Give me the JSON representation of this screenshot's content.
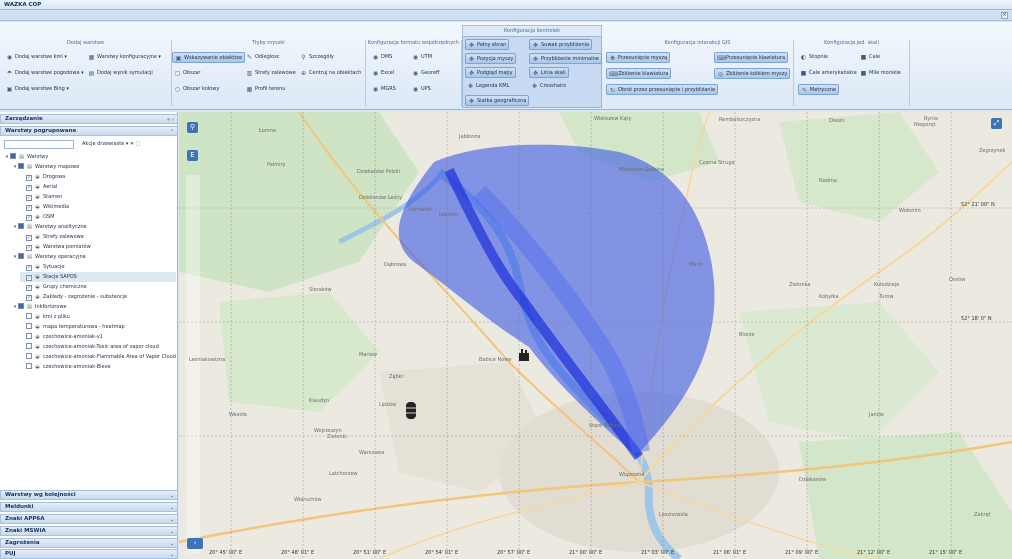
{
  "window": {
    "title": "WAZKA COP"
  },
  "ribbon": {
    "kontrolki_title": "Konfiguracja kontrolek",
    "groups": {
      "warstwy": {
        "title": "Dodaj warstwe",
        "items": [
          "Dodaj warstwe kml ▾",
          "Warstwy konfiguracyjne ▾",
          "Dodaj warstwe pogodowa ▾",
          "Dodaj wynik symulacji",
          "Dodaj warstwe Bing ▾"
        ]
      },
      "tryby": {
        "title": "Tryby myszki",
        "items": [
          "Wskazywanie obiektów",
          "Odleglosc",
          "Szczegóły",
          "Obszar",
          "Strefy zalewowe",
          "Centruj na obiektach",
          "Obszar kołowy",
          "Profil terenu"
        ]
      },
      "format": {
        "title": "Konfiguracja formatu współrzędnych",
        "items": [
          "DMS",
          "UTM",
          "Excel",
          "Georeff",
          "MGRS",
          "UPS"
        ]
      },
      "kontrolki": {
        "items": [
          "Pełny ekran",
          "Suwak przybliżenia",
          "Pozycja myszy",
          "Przybliżenie minimalne",
          "Podgląd mapy",
          "Linia skali",
          "Legenda KML",
          "Crosshairs",
          "Siatka geograficzna"
        ]
      },
      "interakcja": {
        "title": "Konfiguracja interakcji GIS",
        "items": [
          "Przesunięcie myszą",
          "Przesunięcie klawiatura",
          "Zbliżenie klawiatura",
          "Zbliżenie kółkiem myszy",
          "Obrót przez przesunięcie i przybliżanie"
        ]
      },
      "jednostki": {
        "title": "Konfiguracja jed. skali",
        "items": [
          "Stopnie",
          "Cale",
          "Cale amerykańskie",
          "Mile morskie",
          "Metryczne"
        ]
      }
    }
  },
  "left_panel": {
    "header": "Zarządzanie",
    "subheader": "Warstwy pogrupowane",
    "search": {
      "value": "",
      "placeholder": ""
    },
    "actions_label": "Akcje drzewiaste ▾",
    "tree": [
      {
        "label": "Warstwy",
        "level": 0
      },
      {
        "label": "Warstwy mapowe",
        "level": 1
      },
      {
        "label": "Drogowa",
        "level": 2
      },
      {
        "label": "Aerial",
        "level": 2
      },
      {
        "label": "Stamen",
        "level": 2
      },
      {
        "label": "Wikimedia",
        "level": 2
      },
      {
        "label": "OSM",
        "level": 2
      },
      {
        "label": "Warstwy analityczne",
        "level": 1
      },
      {
        "label": "Strefy zalewowe",
        "level": 2
      },
      {
        "label": "Warstwa pomiarów",
        "level": 2
      },
      {
        "label": "Warstwy operacyjne",
        "level": 1
      },
      {
        "label": "Sytuacje",
        "level": 2
      },
      {
        "label": "Stacje SAPOS",
        "level": 2
      },
      {
        "label": "Grupy chemiczne",
        "level": 2
      },
      {
        "label": "Zakłady - zagrożenie - substancje",
        "level": 2
      },
      {
        "label": "Inkfórtorowe",
        "level": 1
      },
      {
        "label": "kml z pliku",
        "level": 2
      },
      {
        "label": "mapa temperaturowa - heatmap",
        "level": 2
      },
      {
        "label": "czechowice-amoniak-v1",
        "level": 2
      },
      {
        "label": "czechowice-amoniak-Toxic area of vapor cloud",
        "level": 2
      },
      {
        "label": "czechowice-amoniak-Flammable Area of Vapor Cloud",
        "level": 2
      },
      {
        "label": "czechowice-amoniak-Bleve",
        "level": 2
      }
    ],
    "bottom_sections": [
      "Warstwy wg kolejności",
      "Meldunki",
      "Znaki APP6A",
      "Znaki MSWiA",
      "Zagrożenia",
      "PUJ"
    ]
  },
  "map": {
    "places": [
      "Łomna",
      "Jabłonna",
      "Wieliszew Kąty",
      "Rembelszczyzna",
      "Olesin",
      "Nieporęt",
      "Rynia",
      "Palmiry",
      "Dziekanów Polski",
      "Dziekanów Leśny",
      "Łomianki",
      "Michałów-Grabina",
      "Czarna Struga",
      "Zegrzynek",
      "Nadma",
      "Izabelin",
      "Dąbrowa",
      "Marki",
      "Zielonka",
      "Kobyłka",
      "Wołomin",
      "Sieraków",
      "Kołodzieje",
      "Turów",
      "Ossów",
      "Lesniakowizna",
      "Mariew",
      "Babice Nowe",
      "Blonie",
      "Ząbki",
      "Klaudyn",
      "Lipków",
      "Janów",
      "Wesoła",
      "Wojcieszyn",
      "Zielonki",
      "Stare Babice",
      "Warszawa",
      "Latchorzew",
      "Wieruchów",
      "Dziekanów",
      "Zakręt",
      "Wiązowna",
      "Lesznowola"
    ],
    "lat_labels": [
      "52° 21' 00\" N",
      "52° 18' 0\" N"
    ],
    "lon_labels": [
      "20° 45' 00\" E",
      "20° 48' 01\" E",
      "20° 51' 00\" E",
      "20° 54' 01\" E",
      "20° 57' 00\" E",
      "21° 00' 00\" E",
      "21° 03' 00\" E",
      "21° 06' 01\" E",
      "21° 09' 00\" E",
      "21° 12' 00\" E",
      "21° 15' 00\" E"
    ],
    "zoom_button": "E"
  }
}
